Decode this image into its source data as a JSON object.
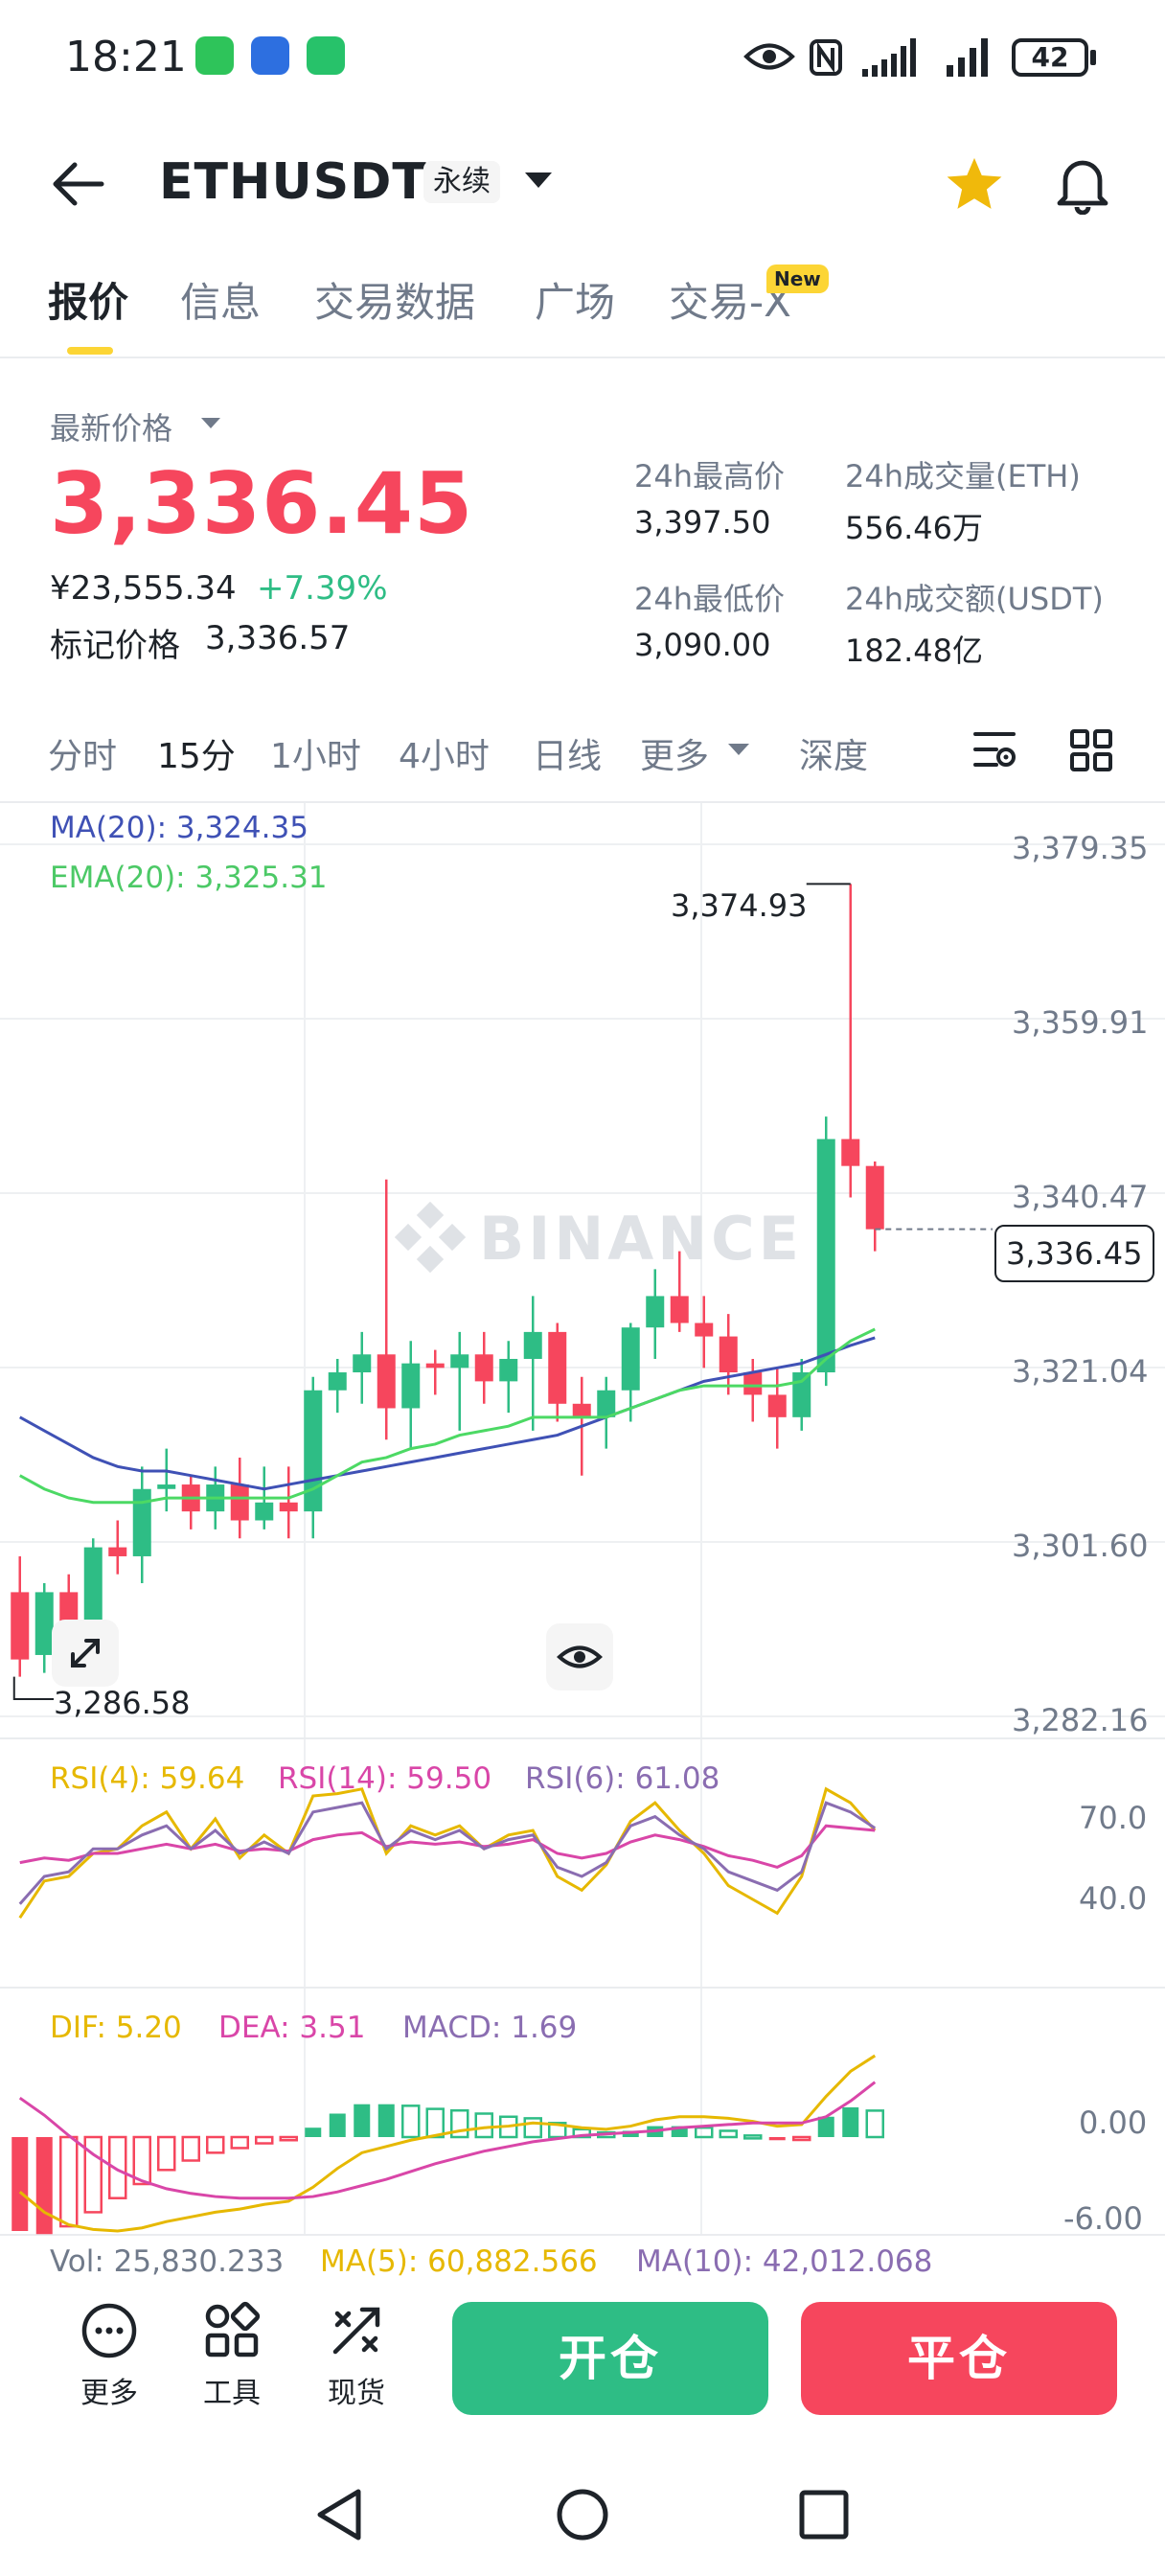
{
  "status_bar": {
    "time": "18:21",
    "battery": "42"
  },
  "header": {
    "symbol": "ETHUSDT",
    "contract_type": "永续"
  },
  "tabs": [
    {
      "label": "报价",
      "active": true
    },
    {
      "label": "信息"
    },
    {
      "label": "交易数据"
    },
    {
      "label": "广场"
    },
    {
      "label": "交易-X",
      "badge": "New"
    }
  ],
  "price": {
    "label": "最新价格",
    "last": "3,336.45",
    "cny": "¥23,555.34",
    "change": "+7.39%",
    "mark_label": "标记价格",
    "mark": "3,336.57"
  },
  "stats": {
    "high_label": "24h最高价",
    "high": "3,397.50",
    "low_label": "24h最低价",
    "low": "3,090.00",
    "vol_label": "24h成交量(ETH)",
    "vol": "556.46万",
    "amt_label": "24h成交额(USDT)",
    "amt": "182.48亿"
  },
  "intervals": [
    "分时",
    "15分",
    "1小时",
    "4小时",
    "日线",
    "更多",
    "深度"
  ],
  "active_interval": "15分",
  "chart": {
    "ma": "MA(20): 3,324.35",
    "ema": "EMA(20): 3,325.31",
    "y_ticks": [
      "3,379.35",
      "3,359.91",
      "3,340.47",
      "3,321.04",
      "3,301.60",
      "3,282.16"
    ],
    "max_label": "3,374.93",
    "min_label": "3,286.58",
    "current": "3,336.45",
    "watermark": "BINANCE",
    "rsi4": "RSI(4): 59.64",
    "rsi14": "RSI(14): 59.50",
    "rsi6": "RSI(6): 61.08",
    "rsi_ticks": [
      "70.0",
      "40.0"
    ],
    "dif": "DIF: 5.20",
    "dea": "DEA: 3.51",
    "macd": "MACD: 1.69",
    "macd_ticks": [
      "0.00",
      "-6.00"
    ],
    "vol": "Vol: 25,830.233",
    "vol_ma5": "MA(5): 60,882.566",
    "vol_ma10": "MA(10): 42,012.068"
  },
  "chart_data": {
    "type": "candlestick",
    "ylim": [
      3282.16,
      3379.35
    ],
    "candles": [
      [
        3296.0,
        3300.0,
        3286.58,
        3288.5
      ],
      [
        3289.0,
        3297.0,
        3287.0,
        3296.0
      ],
      [
        3296.0,
        3298.0,
        3290.0,
        3292.0
      ],
      [
        3292.0,
        3302.0,
        3291.0,
        3301.0
      ],
      [
        3301.0,
        3304.0,
        3298.0,
        3300.0
      ],
      [
        3300.0,
        3310.0,
        3297.0,
        3307.5
      ],
      [
        3307.5,
        3312.0,
        3305.0,
        3308.0
      ],
      [
        3308.0,
        3309.0,
        3303.0,
        3305.0
      ],
      [
        3305.0,
        3310.0,
        3303.0,
        3308.0
      ],
      [
        3308.0,
        3311.0,
        3302.0,
        3304.0
      ],
      [
        3304.0,
        3310.0,
        3303.0,
        3306.0
      ],
      [
        3306.0,
        3310.0,
        3302.0,
        3305.0
      ],
      [
        3305.0,
        3320.0,
        3302.0,
        3318.5
      ],
      [
        3318.5,
        3322.0,
        3316.0,
        3320.5
      ],
      [
        3320.5,
        3325.0,
        3317.0,
        3322.5
      ],
      [
        3322.5,
        3342.0,
        3313.0,
        3316.5
      ],
      [
        3316.5,
        3324.0,
        3312.0,
        3321.5
      ],
      [
        3321.5,
        3323.0,
        3318.0,
        3321.0
      ],
      [
        3321.0,
        3325.0,
        3314.0,
        3322.5
      ],
      [
        3322.5,
        3325.0,
        3317.0,
        3319.5
      ],
      [
        3319.5,
        3324.0,
        3316.0,
        3322.0
      ],
      [
        3322.0,
        3329.0,
        3314.0,
        3325.0
      ],
      [
        3325.0,
        3326.0,
        3315.0,
        3317.0
      ],
      [
        3317.0,
        3320.0,
        3309.0,
        3315.5
      ],
      [
        3315.5,
        3320.0,
        3312.0,
        3318.5
      ],
      [
        3318.5,
        3326.0,
        3315.0,
        3325.5
      ],
      [
        3325.5,
        3332.0,
        3322.0,
        3329.0
      ],
      [
        3329.0,
        3334.0,
        3325.0,
        3326.0
      ],
      [
        3326.0,
        3329.0,
        3321.0,
        3324.5
      ],
      [
        3324.5,
        3327.0,
        3318.0,
        3320.5
      ],
      [
        3320.5,
        3322.0,
        3315.0,
        3318.0
      ],
      [
        3318.0,
        3321.0,
        3312.0,
        3315.5
      ],
      [
        3315.5,
        3322.0,
        3314.0,
        3320.5
      ],
      [
        3320.5,
        3349.0,
        3319.0,
        3346.5
      ],
      [
        3346.5,
        3374.93,
        3340.0,
        3343.5
      ],
      [
        3343.5,
        3344.0,
        3334.0,
        3336.45
      ]
    ],
    "ma20": [
      3315.5,
      3314.0,
      3312.5,
      3311.0,
      3310.0,
      3309.5,
      3309.5,
      3309.0,
      3308.5,
      3308.0,
      3307.5,
      3308.0,
      3308.5,
      3309.0,
      3309.5,
      3310.0,
      3310.5,
      3311.0,
      3311.5,
      3312.0,
      3312.5,
      3313.0,
      3313.5,
      3314.5,
      3315.5,
      3316.5,
      3317.5,
      3318.5,
      3319.5,
      3320.0,
      3320.5,
      3321.0,
      3321.5,
      3322.5,
      3323.5,
      3324.35
    ],
    "ema20": [
      3309.0,
      3307.5,
      3306.5,
      3306.0,
      3306.0,
      3306.0,
      3306.5,
      3306.5,
      3306.5,
      3306.5,
      3306.5,
      3306.5,
      3307.5,
      3309.0,
      3310.5,
      3311.0,
      3312.0,
      3312.5,
      3313.5,
      3314.0,
      3314.5,
      3315.5,
      3315.5,
      3315.5,
      3315.5,
      3316.5,
      3317.5,
      3318.5,
      3319.0,
      3319.0,
      3319.0,
      3319.0,
      3319.5,
      3322.0,
      3324.0,
      3325.31
    ],
    "rsi_ylim": [
      0,
      100
    ],
    "rsi4": [
      22,
      38,
      40,
      50,
      52,
      62,
      68,
      52,
      65,
      48,
      58,
      50,
      75,
      76,
      78,
      50,
      62,
      58,
      62,
      52,
      58,
      60,
      40,
      34,
      45,
      64,
      72,
      60,
      50,
      36,
      30,
      24,
      40,
      78,
      72,
      60
    ],
    "rsi14": [
      46,
      48,
      47,
      50,
      50,
      52,
      54,
      52,
      54,
      51,
      52,
      51,
      56,
      58,
      59,
      53,
      55,
      54,
      55,
      53,
      54,
      56,
      50,
      48,
      50,
      55,
      58,
      56,
      53,
      49,
      47,
      44,
      49,
      62,
      61,
      60
    ],
    "rsi6": [
      28,
      40,
      42,
      52,
      52,
      58,
      62,
      52,
      60,
      50,
      55,
      50,
      68,
      70,
      72,
      52,
      60,
      56,
      60,
      52,
      56,
      58,
      44,
      40,
      46,
      62,
      66,
      58,
      52,
      42,
      38,
      34,
      42,
      72,
      68,
      61
    ],
    "dif": [
      -3.5,
      -4.8,
      -5.6,
      -5.9,
      -6.0,
      -5.8,
      -5.4,
      -5.1,
      -4.8,
      -4.6,
      -4.3,
      -4.1,
      -3.2,
      -2.0,
      -1.0,
      -0.6,
      -0.2,
      0.1,
      0.4,
      0.6,
      0.7,
      0.9,
      0.8,
      0.6,
      0.5,
      0.7,
      1.1,
      1.3,
      1.3,
      1.2,
      1.0,
      0.7,
      0.8,
      2.6,
      4.2,
      5.2
    ],
    "dea": [
      2.5,
      1.4,
      0.1,
      -1.1,
      -2.1,
      -2.8,
      -3.3,
      -3.6,
      -3.8,
      -3.9,
      -3.9,
      -3.9,
      -3.8,
      -3.5,
      -3.1,
      -2.7,
      -2.2,
      -1.7,
      -1.3,
      -0.9,
      -0.6,
      -0.3,
      -0.1,
      0.1,
      0.2,
      0.3,
      0.4,
      0.6,
      0.7,
      0.8,
      0.9,
      0.9,
      0.9,
      1.3,
      2.3,
      3.51
    ],
    "macd_hist": [
      -6.0,
      -6.2,
      -5.7,
      -4.8,
      -3.9,
      -3.0,
      -2.1,
      -1.5,
      -1.0,
      -0.7,
      -0.4,
      -0.2,
      0.6,
      1.5,
      2.1,
      2.1,
      2.0,
      1.8,
      1.7,
      1.5,
      1.3,
      1.2,
      0.9,
      0.5,
      0.3,
      0.4,
      0.7,
      0.7,
      0.6,
      0.4,
      0.1,
      -0.2,
      -0.1,
      1.3,
      1.9,
      1.69
    ],
    "macd_ylim": [
      -6.5,
      6.5
    ]
  },
  "bottom_bar": {
    "more": "更多",
    "tools": "工具",
    "spot": "现货",
    "open": "开仓",
    "close": "平仓"
  },
  "colors": {
    "up": "#2ebd85",
    "down": "#f6465d",
    "accent": "#fcd535",
    "ma": "#3f51b5",
    "ema": "#4cd964",
    "rsi4": "#e6b800",
    "rsi14": "#d946a8",
    "rsi6": "#8a6db1"
  }
}
